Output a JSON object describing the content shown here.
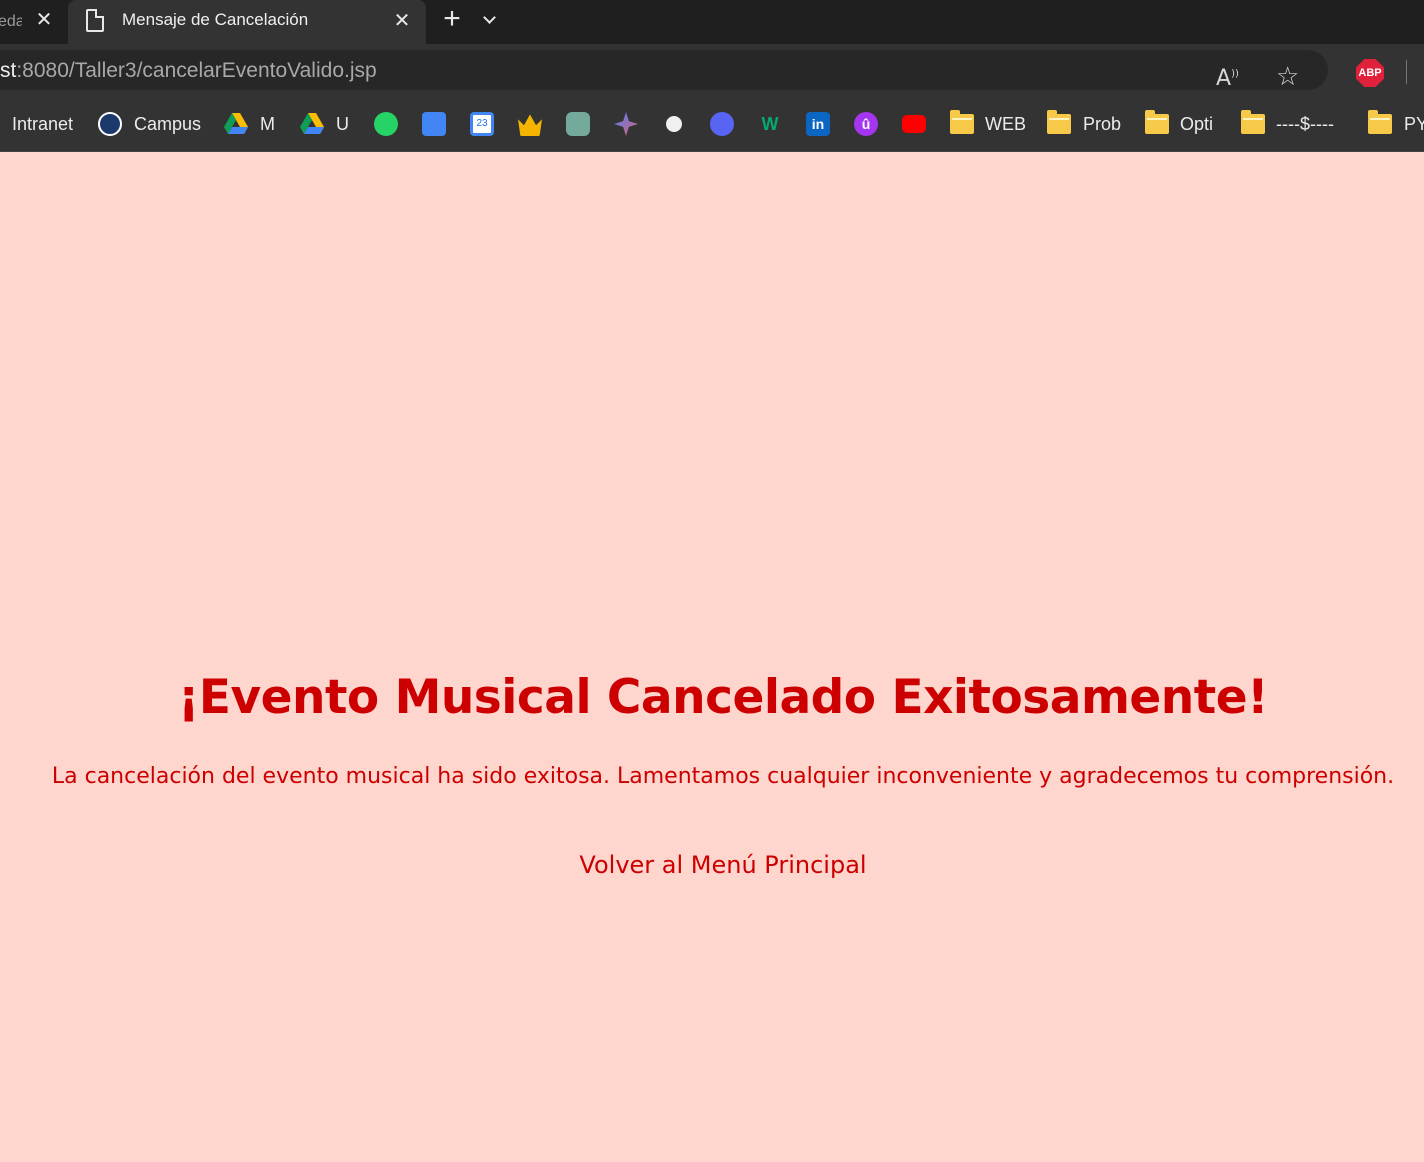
{
  "browser": {
    "tabs": [
      {
        "title": "eda"
      },
      {
        "title": "Mensaje de Cancelación"
      }
    ],
    "close_glyph": "✕",
    "new_tab_glyph": "+",
    "address": {
      "host_part": "st",
      "rest": ":8080/Taller3/cancelarEventoValido.jsp"
    },
    "read_aloud_glyph": "A",
    "read_aloud_sup": "))",
    "favorite_glyph": "☆",
    "adblock_label": "ABP"
  },
  "bookmarks": [
    {
      "label": "Intranet",
      "icon": "none"
    },
    {
      "label": "Campus",
      "icon": "campus-icon"
    },
    {
      "label": "M",
      "icon": "google-drive-icon"
    },
    {
      "label": "U",
      "icon": "google-drive-icon"
    },
    {
      "label": "",
      "icon": "whatsapp-icon"
    },
    {
      "label": "",
      "icon": "google-docs-icon"
    },
    {
      "label": "",
      "icon": "google-calendar-icon",
      "badge": "23"
    },
    {
      "label": "",
      "icon": "crown-icon"
    },
    {
      "label": "",
      "icon": "chatgpt-icon"
    },
    {
      "label": "",
      "icon": "gemini-icon"
    },
    {
      "label": "",
      "icon": "github-icon"
    },
    {
      "label": "",
      "icon": "discord-icon"
    },
    {
      "label": "",
      "icon": "w3-icon",
      "badge": "W"
    },
    {
      "label": "",
      "icon": "linkedin-icon",
      "badge": "in"
    },
    {
      "label": "",
      "icon": "udemy-icon",
      "badge": "û"
    },
    {
      "label": "",
      "icon": "youtube-icon"
    },
    {
      "label": "WEB",
      "icon": "folder-icon"
    },
    {
      "label": "Prob",
      "icon": "folder-icon"
    },
    {
      "label": "Opti",
      "icon": "folder-icon"
    },
    {
      "label": "----$----",
      "icon": "folder-icon"
    },
    {
      "label": "PY",
      "icon": "folder-icon"
    }
  ],
  "content": {
    "heading": "¡Evento Musical Cancelado Exitosamente!",
    "message": "La cancelación del evento musical ha sido exitosa. Lamentamos cualquier inconveniente y agradecemos tu comprensión.",
    "back_link": "Volver al Menú Principal"
  },
  "colors": {
    "page_background": "#ffd6cd",
    "text_accent": "#cc0000"
  }
}
